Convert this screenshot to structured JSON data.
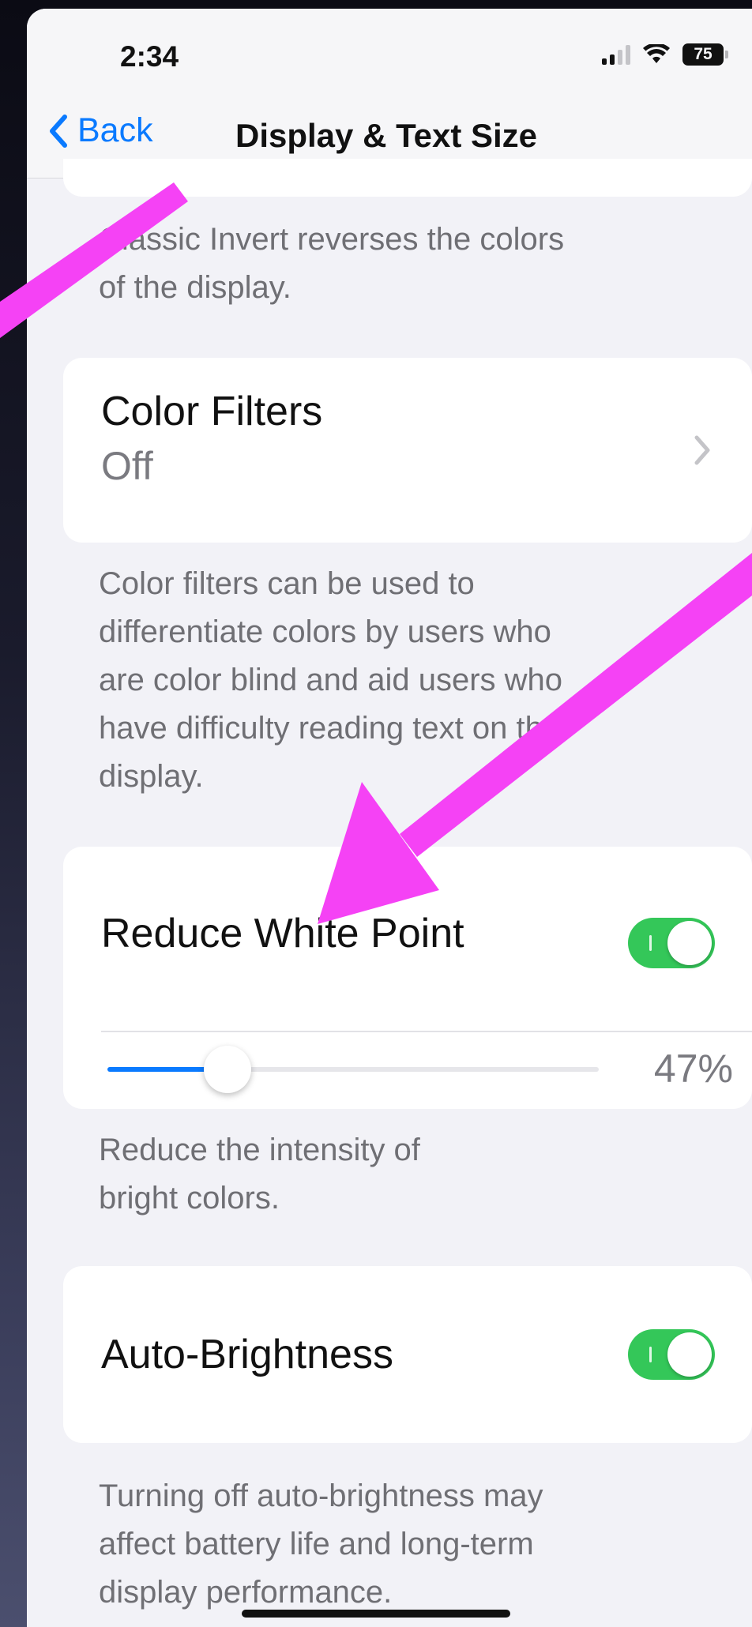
{
  "status_bar": {
    "time": "2:34",
    "battery": "75",
    "icons": [
      "cellular-signal-icon",
      "wifi-icon",
      "battery-icon"
    ]
  },
  "nav": {
    "back_label": "Back",
    "title": "Display & Text Size"
  },
  "sections": {
    "classic_invert": {
      "footnote": "Classic Invert reverses the colors of the display.",
      "footnote_visible_line1": "Classic Invert reverses the colors",
      "footnote_visible_line2": "of the display."
    },
    "color_filters": {
      "title": "Color Filters",
      "value": "Off",
      "footnote_lines": [
        "Color filters can be used to",
        "differentiate colors by users who",
        "are color blind and aid users who",
        "have difficulty reading text on the",
        "display."
      ]
    },
    "reduce_white_point": {
      "title": "Reduce White Point",
      "enabled": true,
      "slider_percent": 47,
      "slider_label": "47%",
      "footnote_lines": [
        "Reduce the intensity of",
        "bright colors."
      ]
    },
    "auto_brightness": {
      "title": "Auto-Brightness",
      "enabled": true,
      "footnote_lines": [
        "Turning off auto-brightness may",
        "affect battery life and long-term",
        "display performance."
      ]
    }
  },
  "annotation_color": "#f542f5",
  "accent_color": "#0a7aff",
  "toggle_on_color": "#34c759"
}
